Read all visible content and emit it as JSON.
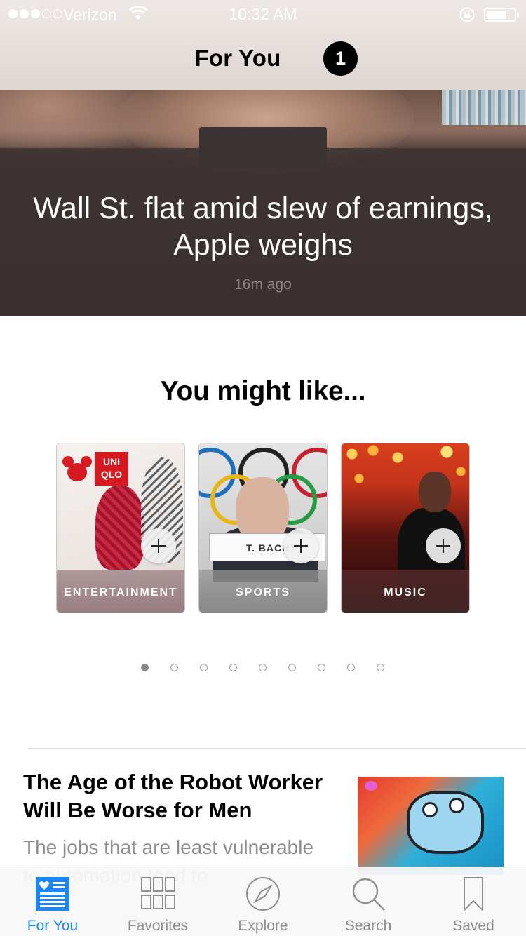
{
  "status_bar": {
    "carrier": "Verizon",
    "time": "10:32 AM",
    "signal_bars": 3,
    "signal_total": 5
  },
  "nav": {
    "title": "For You",
    "badge_count": "1"
  },
  "hero": {
    "headline": "Wall St. flat amid slew of earnings, Apple weighs",
    "age": "16m ago"
  },
  "recommendations": {
    "heading": "You might like...",
    "cards": [
      {
        "label": "ENTERTAINMENT",
        "icon": "plus-icon"
      },
      {
        "label": "SPORTS",
        "icon": "plus-icon"
      },
      {
        "label": "MUSIC",
        "icon": "plus-icon"
      }
    ],
    "page_count": 9,
    "current_page": 1
  },
  "article": {
    "title": "The Age of the Robot Worker Will Be Worse for Men",
    "description": "The jobs that are least vulnerable to automation tend to"
  },
  "tabbar": {
    "tabs": [
      {
        "label": "For You",
        "icon": "for-you-icon",
        "active": true
      },
      {
        "label": "Favorites",
        "icon": "favorites-grid-icon",
        "active": false
      },
      {
        "label": "Explore",
        "icon": "compass-icon",
        "active": false
      },
      {
        "label": "Search",
        "icon": "search-icon",
        "active": false
      },
      {
        "label": "Saved",
        "icon": "bookmark-icon",
        "active": false
      }
    ]
  },
  "colors": {
    "accent": "#1b86f5",
    "inactive": "#8e8e8e",
    "badge": "#000000"
  }
}
